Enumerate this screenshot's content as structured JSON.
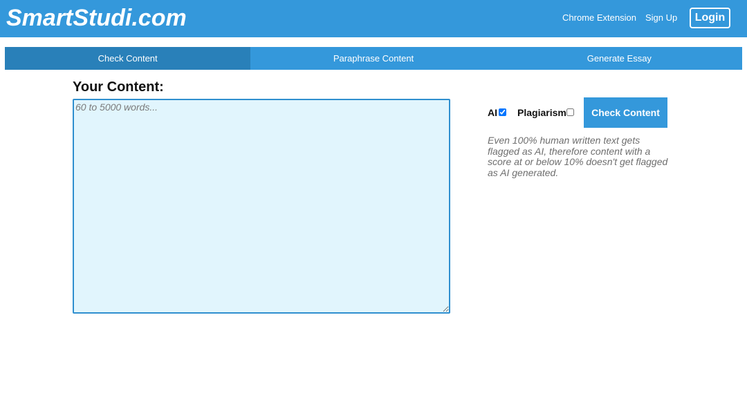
{
  "header": {
    "brand": "SmartStudi.com",
    "nav": {
      "chrome_extension": "Chrome Extension",
      "sign_up": "Sign Up",
      "login": "Login"
    }
  },
  "tabs": [
    {
      "label": "Check Content",
      "active": true
    },
    {
      "label": "Paraphrase Content",
      "active": false
    },
    {
      "label": "Generate Essay",
      "active": false
    }
  ],
  "main": {
    "content_label": "Your Content:",
    "textarea": {
      "value": "",
      "placeholder": "60 to 5000 words..."
    },
    "options": {
      "ai": {
        "label": "AI",
        "checked": true
      },
      "plagiarism": {
        "label": "Plagiarism",
        "checked": false
      }
    },
    "check_button": "Check Content",
    "note": "Even 100% human written text gets flagged as AI, therefore content with a score at or below 10% doesn't get flagged as AI generated."
  },
  "colors": {
    "brand_blue": "#3498db",
    "active_tab": "#2980b9",
    "textarea_bg": "#e1f5fd"
  }
}
